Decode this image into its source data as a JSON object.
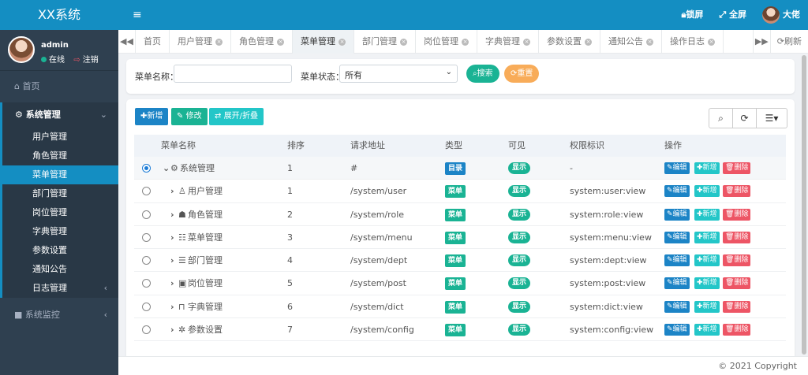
{
  "app": {
    "logo": "XX系统"
  },
  "user": {
    "name": "admin",
    "status": "在线",
    "logout": "注销"
  },
  "sidebar": {
    "home": "首页",
    "system": "系统管理",
    "chevron_open": "⌄",
    "chevron": "‹",
    "items": [
      "用户管理",
      "角色管理",
      "菜单管理",
      "部门管理",
      "岗位管理",
      "字典管理",
      "参数设置",
      "通知公告",
      "日志管理"
    ],
    "monitor": "系统监控"
  },
  "header": {
    "burger": "≡",
    "lock": "锁屏",
    "fullscreen": "全屏",
    "user": "大佬"
  },
  "tabs": {
    "items": [
      "首页",
      "用户管理",
      "角色管理",
      "菜单管理",
      "部门管理",
      "岗位管理",
      "字典管理",
      "参数设置",
      "通知公告",
      "操作日志"
    ],
    "refresh": "刷新"
  },
  "search": {
    "name_label": "菜单名称：",
    "status_label": "菜单状态：",
    "status_value": "所有",
    "search_btn": "搜索",
    "reset_btn": "重置"
  },
  "toolbar": {
    "add": "新增",
    "edit": "修改",
    "expand": "展开/折叠"
  },
  "table": {
    "headers": [
      "菜单名称",
      "排序",
      "请求地址",
      "类型",
      "可见",
      "权限标识",
      "操作"
    ],
    "rows": [
      {
        "icon": "⚙",
        "name": "系统管理",
        "order": "1",
        "url": "#",
        "type": "目录",
        "visible": "显示",
        "perm": "-"
      },
      {
        "icon": "♙",
        "name": "用户管理",
        "order": "1",
        "url": "/system/user",
        "type": "菜单",
        "visible": "显示",
        "perm": "system:user:view"
      },
      {
        "icon": "☗",
        "name": "角色管理",
        "order": "2",
        "url": "/system/role",
        "type": "菜单",
        "visible": "显示",
        "perm": "system:role:view"
      },
      {
        "icon": "☷",
        "name": "菜单管理",
        "order": "3",
        "url": "/system/menu",
        "type": "菜单",
        "visible": "显示",
        "perm": "system:menu:view"
      },
      {
        "icon": "☰",
        "name": "部门管理",
        "order": "4",
        "url": "/system/dept",
        "type": "菜单",
        "visible": "显示",
        "perm": "system:dept:view"
      },
      {
        "icon": "▣",
        "name": "岗位管理",
        "order": "5",
        "url": "/system/post",
        "type": "菜单",
        "visible": "显示",
        "perm": "system:post:view"
      },
      {
        "icon": "⊓",
        "name": "字典管理",
        "order": "6",
        "url": "/system/dict",
        "type": "菜单",
        "visible": "显示",
        "perm": "system:dict:view"
      },
      {
        "icon": "✲",
        "name": "参数设置",
        "order": "7",
        "url": "/system/config",
        "type": "菜单",
        "visible": "显示",
        "perm": "system:config:view"
      }
    ],
    "actions": {
      "edit": "编辑",
      "add": "新增",
      "del": "删除"
    }
  },
  "footer": {
    "copyright": "© 2021 Copyright"
  },
  "colors": {
    "primary": "#148ec2",
    "sidebar": "#2f4050",
    "success": "#1ab394",
    "danger": "#ed5565",
    "warning": "#f8ac59",
    "info": "#23c6c8"
  }
}
